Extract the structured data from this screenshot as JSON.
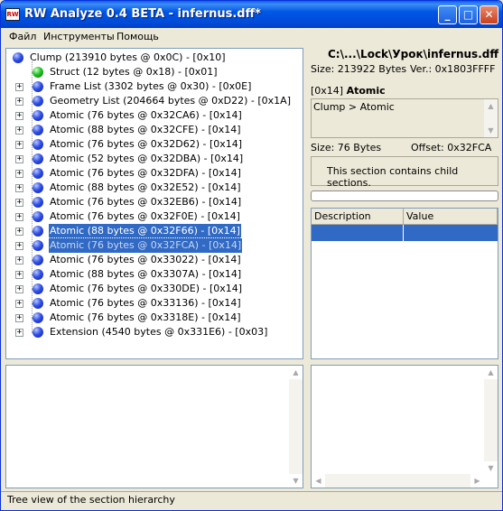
{
  "window": {
    "title": "RW Analyze 0.4 BETA - infernus.dff*",
    "icon": "RW"
  },
  "menu": [
    "Файл",
    "Инструменты",
    "Помощь"
  ],
  "tree": [
    {
      "label": "Clump  (213910 bytes @ 0x0C) - [0x10]",
      "icon": "blue",
      "expander": false
    },
    {
      "label": "Struct  (12 bytes @ 0x18) - [0x01]",
      "icon": "green",
      "expander": false
    },
    {
      "label": "Frame List  (3302 bytes @ 0x30) - [0x0E]",
      "icon": "blue",
      "expander": true
    },
    {
      "label": "Geometry List  (204664 bytes @ 0xD22) - [0x1A]",
      "icon": "blue",
      "expander": true
    },
    {
      "label": "Atomic  (76 bytes @ 0x32CA6) - [0x14]",
      "icon": "blue",
      "expander": true
    },
    {
      "label": "Atomic  (88 bytes @ 0x32CFE) - [0x14]",
      "icon": "blue",
      "expander": true
    },
    {
      "label": "Atomic  (76 bytes @ 0x32D62) - [0x14]",
      "icon": "blue",
      "expander": true
    },
    {
      "label": "Atomic  (52 bytes @ 0x32DBA) - [0x14]",
      "icon": "blue",
      "expander": true
    },
    {
      "label": "Atomic  (76 bytes @ 0x32DFA) - [0x14]",
      "icon": "blue",
      "expander": true
    },
    {
      "label": "Atomic  (88 bytes @ 0x32E52) - [0x14]",
      "icon": "blue",
      "expander": true
    },
    {
      "label": "Atomic  (76 bytes @ 0x32EB6) - [0x14]",
      "icon": "blue",
      "expander": true
    },
    {
      "label": "Atomic  (76 bytes @ 0x32F0E) - [0x14]",
      "icon": "blue",
      "expander": true
    },
    {
      "label": "Atomic  (88 bytes @ 0x32F66) - [0x14]",
      "icon": "blue",
      "expander": true,
      "state": "selected"
    },
    {
      "label": "Atomic  (76 bytes @ 0x32FCA) - [0x14]",
      "icon": "blue",
      "expander": true,
      "state": "drag"
    },
    {
      "label": "Atomic  (76 bytes @ 0x33022) - [0x14]",
      "icon": "blue",
      "expander": true
    },
    {
      "label": "Atomic  (88 bytes @ 0x3307A) - [0x14]",
      "icon": "blue",
      "expander": true
    },
    {
      "label": "Atomic  (76 bytes @ 0x330DE) - [0x14]",
      "icon": "blue",
      "expander": true
    },
    {
      "label": "Atomic  (76 bytes @ 0x33136) - [0x14]",
      "icon": "blue",
      "expander": true
    },
    {
      "label": "Atomic  (76 bytes @ 0x3318E) - [0x14]",
      "icon": "blue",
      "expander": true
    },
    {
      "label": "Extension  (4540 bytes @ 0x331E6) - [0x03]",
      "icon": "blue",
      "expander": true
    }
  ],
  "info": {
    "path": "C:\\...\\Lock\\Урок\\infernus.dff",
    "size": "Size: 213922 Bytes",
    "version": "Ver.: 0x1803FFFF",
    "section_id": "[0x14]",
    "section_name": "Atomic",
    "hierarchy": "Clump > Atomic",
    "section_size": "Size: 76 Bytes",
    "offset": "Offset: 0x32FCA",
    "child_msg": "This section contains child sections."
  },
  "grid": {
    "col_description": "Description",
    "col_value": "Value"
  },
  "status": "Tree view of the section hierarchy",
  "colors": {
    "selection": "#316ac5",
    "titlebar": "#0054e3",
    "panel_border": "#7f9db9"
  }
}
